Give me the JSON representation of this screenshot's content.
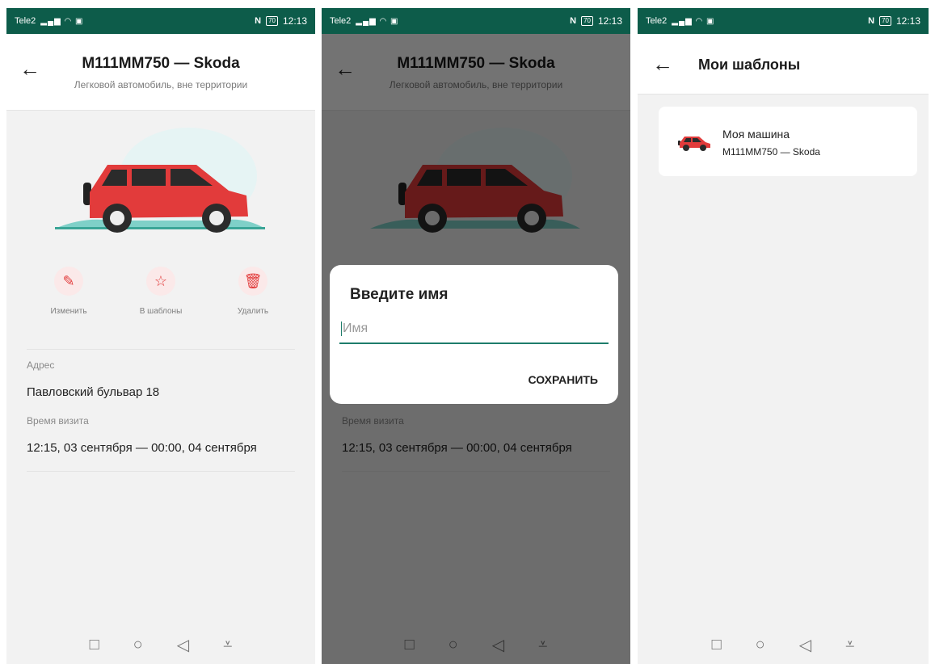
{
  "status": {
    "carrier": "Tele2",
    "time": "12:13",
    "battery": "70"
  },
  "details": {
    "title": "M111MM750 — Skoda",
    "subtitle": "Легковой автомобиль, вне территории",
    "actions": [
      {
        "label": "Изменить",
        "icon": "edit-icon"
      },
      {
        "label": "В шаблоны",
        "icon": "star-icon"
      },
      {
        "label": "Удалить",
        "icon": "trash-icon"
      }
    ],
    "address_label": "Адрес",
    "address_value": "Павловский бульвар 18",
    "visit_label": "Время визита",
    "visit_value": "12:15, 03 сентября — 00:00, 04 сентября"
  },
  "dialog": {
    "title": "Введите имя",
    "placeholder": "Имя",
    "save": "СОХРАНИТЬ"
  },
  "templates": {
    "title": "Мои шаблоны",
    "items": [
      {
        "name": "Моя машина",
        "plate": "M111MM750",
        "brand": "Skoda"
      }
    ]
  },
  "colors": {
    "statusbar": "#0d5c4a",
    "accent": "#1e7d6b",
    "action_icon": "#e23b3b",
    "car": "#e23b3b"
  }
}
